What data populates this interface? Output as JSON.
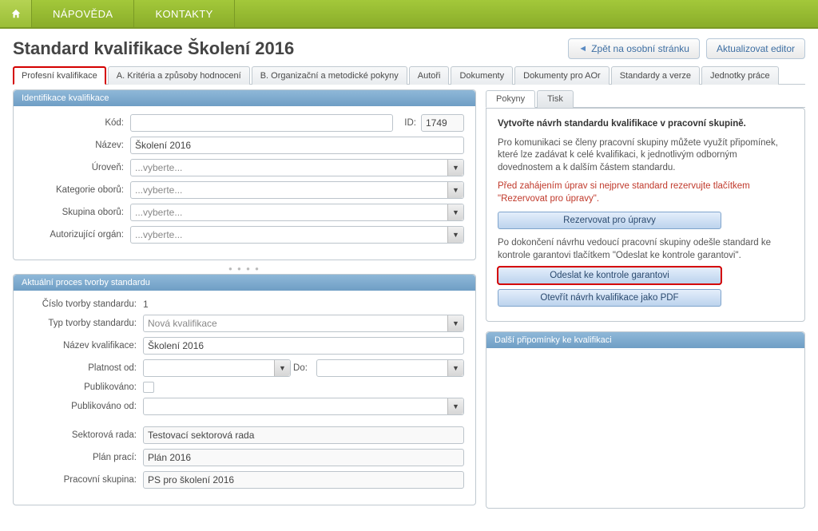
{
  "nav": {
    "home": "home",
    "napoveda": "NÁPOVĚDA",
    "kontakty": "KONTAKTY"
  },
  "page": {
    "title": "Standard kvalifikace Školení 2016"
  },
  "headbtns": {
    "back": "Zpět na osobní stránku",
    "update": "Aktualizovat editor"
  },
  "tabs": {
    "t0": "Profesní kvalifikace",
    "t1": "A. Kritéria a způsoby hodnocení",
    "t2": "B. Organizační a metodické pokyny",
    "t3": "Autoři",
    "t4": "Dokumenty",
    "t5": "Dokumenty pro AOr",
    "t6": "Standardy a verze",
    "t7": "Jednotky práce"
  },
  "ident": {
    "header": "Identifikace kvalifikace",
    "kod_label": "Kód:",
    "kod": "",
    "id_label": "ID:",
    "id": "1749",
    "nazev_label": "Název:",
    "nazev": "Školení 2016",
    "uroven_label": "Úroveň:",
    "uroven": "...vyberte...",
    "katoboru_label": "Kategorie oborů:",
    "katoboru": "...vyberte...",
    "skoboru_label": "Skupina oborů:",
    "skoboru": "...vyberte...",
    "autorg_label": "Autorizující orgán:",
    "autorg": "...vyberte..."
  },
  "proces": {
    "header": "Aktuální proces tvorby standardu",
    "cislo_label": "Číslo tvorby standardu:",
    "cislo": "1",
    "typ_label": "Typ tvorby standardu:",
    "typ": "Nová kvalifikace",
    "nazevk_label": "Název kvalifikace:",
    "nazevk": "Školení 2016",
    "platod_label": "Platnost od:",
    "platdo_label": "Do:",
    "publ_label": "Publikováno:",
    "publod_label": "Publikováno od:",
    "rada_label": "Sektorová rada:",
    "rada": "Testovací sektorová rada",
    "plan_label": "Plán prací:",
    "plan": "Plán 2016",
    "skupina_label": "Pracovní skupina:",
    "skupina": "PS pro školení 2016"
  },
  "right": {
    "subtabs": {
      "pokyny": "Pokyny",
      "tisk": "Tisk"
    },
    "instr_bold": "Vytvořte návrh standardu kvalifikace v pracovní skupině.",
    "instr_p1": "Pro komunikaci se členy pracovní skupiny můžete využít připomínek, které lze zadávat k celé kvalifikaci, k jednotlivým odborným dovednostem a k dalším částem standardu.",
    "warn": "Před zahájením úprav si nejprve standard rezervujte tlačítkem \"Rezervovat pro úpravy\".",
    "btn_reserve": "Rezervovat pro úpravy",
    "instr_p2": "Po dokončení návrhu vedoucí pracovní skupiny odešle standard ke kontrole garantovi tlačítkem \"Odeslat ke kontrole garantovi\".",
    "btn_send": "Odeslat ke kontrole garantovi",
    "btn_pdf": "Otevřít návrh kvalifikace jako PDF",
    "comments_hd": "Další připomínky ke kvalifikaci"
  }
}
